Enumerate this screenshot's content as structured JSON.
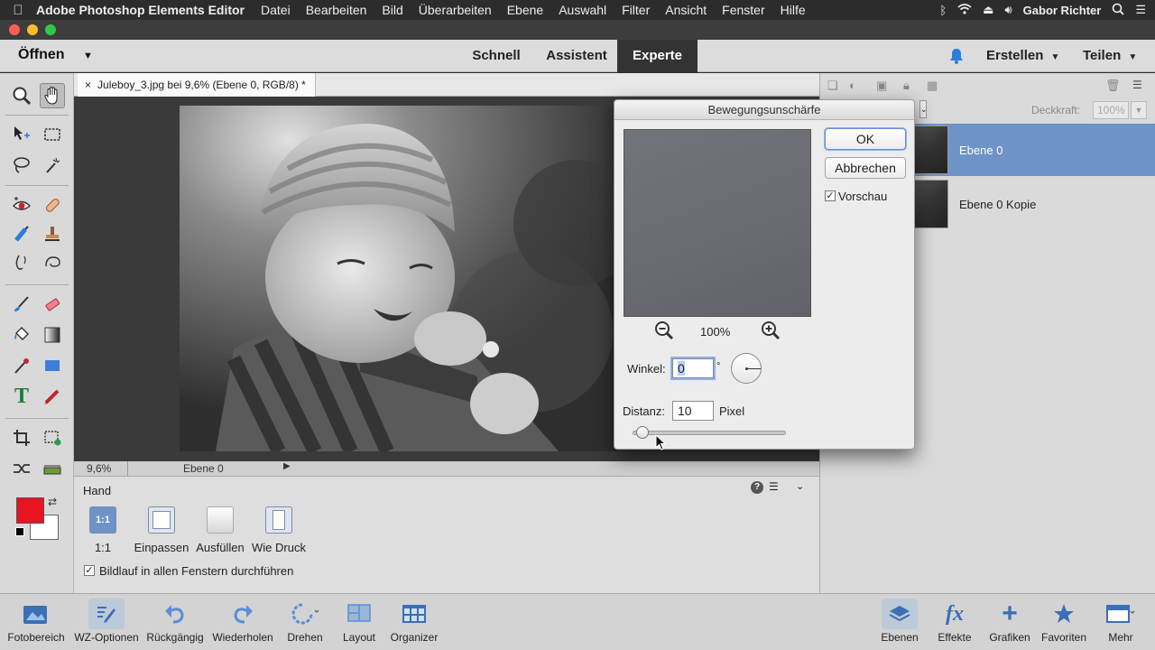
{
  "menubar": {
    "app_name": "Adobe Photoshop Elements Editor",
    "items": [
      "Datei",
      "Bearbeiten",
      "Bild",
      "Überarbeiten",
      "Ebene",
      "Auswahl",
      "Filter",
      "Ansicht",
      "Fenster",
      "Hilfe"
    ],
    "user": "Gabor Richter"
  },
  "modebar": {
    "open_label": "Öffnen",
    "modes": [
      "Schnell",
      "Assistent",
      "Experte"
    ],
    "active_mode": "Experte",
    "create_label": "Erstellen",
    "share_label": "Teilen"
  },
  "document": {
    "tab_title": "Juleboy_3.jpg bei 9,6% (Ebene 0, RGB/8) *",
    "zoom": "9,6%",
    "status_layer": "Ebene 0"
  },
  "options": {
    "tool_name": "Hand",
    "buttons": [
      "1:1",
      "Einpassen",
      "Ausfüllen",
      "Wie Druck"
    ],
    "btn_1to1_icon_text": "1:1",
    "checkbox_label": "Bildlauf in allen Fenstern durchführen",
    "checkbox_checked": true
  },
  "layers_panel": {
    "opacity_label": "Deckkraft:",
    "opacity_value": "100%",
    "layers": [
      {
        "name": "Ebene 0",
        "selected": true
      },
      {
        "name": "Ebene 0 Kopie",
        "selected": false
      }
    ]
  },
  "dialog": {
    "title": "Bewegungsunschärfe",
    "ok_label": "OK",
    "cancel_label": "Abbrechen",
    "preview_label": "Vorschau",
    "preview_checked": true,
    "zoom_value": "100%",
    "angle_label": "Winkel:",
    "angle_value": "0",
    "angle_unit": "°",
    "distance_label": "Distanz:",
    "distance_value": "10",
    "distance_unit": "Pixel",
    "distance_slider_fraction": 0.02
  },
  "bottombar": {
    "left": [
      "Fotobereich",
      "WZ-Optionen",
      "Rückgängig",
      "Wiederholen",
      "Drehen",
      "Layout",
      "Organizer"
    ],
    "right": [
      "Ebenen",
      "Effekte",
      "Grafiken",
      "Favoriten",
      "Mehr"
    ]
  },
  "colors": {
    "foreground": "#e8141f",
    "background": "#ffffff",
    "accent_blue": "#6f93c6"
  }
}
